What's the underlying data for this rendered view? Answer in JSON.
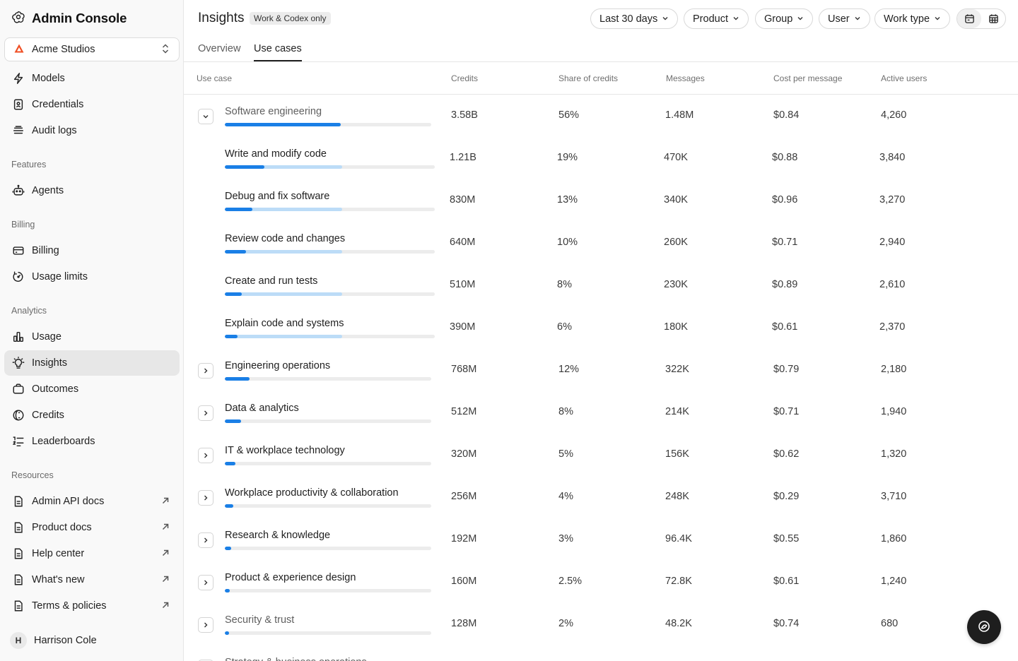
{
  "app": {
    "title": "Admin Console"
  },
  "org": {
    "name": "Acme Studios"
  },
  "sidebar": {
    "top_items": [
      {
        "label": "Models",
        "icon": "bolt-icon"
      },
      {
        "label": "Credentials",
        "icon": "id-badge-icon"
      },
      {
        "label": "Audit logs",
        "icon": "list-stack-icon"
      }
    ],
    "features_label": "Features",
    "features_items": [
      {
        "label": "Agents",
        "icon": "robot-icon"
      }
    ],
    "billing_label": "Billing",
    "billing_items": [
      {
        "label": "Billing",
        "icon": "credit-card-icon"
      },
      {
        "label": "Usage limits",
        "icon": "gauge-icon"
      }
    ],
    "analytics_label": "Analytics",
    "analytics_items": [
      {
        "label": "Usage",
        "icon": "bar-chart-icon"
      },
      {
        "label": "Insights",
        "icon": "lightbulb-icon",
        "active": true
      },
      {
        "label": "Outcomes",
        "icon": "briefcase-icon"
      },
      {
        "label": "Credits",
        "icon": "coin-icon"
      },
      {
        "label": "Leaderboards",
        "icon": "ranked-list-icon"
      }
    ],
    "resources_label": "Resources",
    "resources_items": [
      {
        "label": "Admin API docs",
        "icon": "document-icon"
      },
      {
        "label": "Product docs",
        "icon": "document-icon"
      },
      {
        "label": "Help center",
        "icon": "document-icon"
      },
      {
        "label": "What's new",
        "icon": "document-icon"
      },
      {
        "label": "Terms & policies",
        "icon": "document-icon"
      }
    ],
    "user": {
      "initial": "H",
      "name": "Harrison Cole"
    }
  },
  "header": {
    "title": "Insights",
    "badge": "Work & Codex only",
    "filters": [
      "Last 30 days",
      "Product",
      "Group",
      "User",
      "Work type"
    ],
    "tabs": [
      {
        "label": "Overview"
      },
      {
        "label": "Use cases",
        "active": true
      }
    ]
  },
  "table": {
    "columns": [
      "Use case",
      "Credits",
      "Share of credits",
      "Messages",
      "Cost per message",
      "Active users"
    ],
    "rows": [
      {
        "name": "Software engineering",
        "credits": "3.58B",
        "share": "56%",
        "messages": "1.48M",
        "cost": "$0.84",
        "users": "4,260",
        "share_fraction": 0.56,
        "expanded": true,
        "level": 0,
        "muted": true
      },
      {
        "name": "Write and modify code",
        "credits": "1.21B",
        "share": "19%",
        "messages": "470K",
        "cost": "$0.88",
        "users": "3,840",
        "share_fraction": 0.19,
        "level": 1
      },
      {
        "name": "Debug and fix software",
        "credits": "830M",
        "share": "13%",
        "messages": "340K",
        "cost": "$0.96",
        "users": "3,270",
        "share_fraction": 0.13,
        "level": 1
      },
      {
        "name": "Review code and changes",
        "credits": "640M",
        "share": "10%",
        "messages": "260K",
        "cost": "$0.71",
        "users": "2,940",
        "share_fraction": 0.1,
        "level": 1
      },
      {
        "name": "Create and run tests",
        "credits": "510M",
        "share": "8%",
        "messages": "230K",
        "cost": "$0.89",
        "users": "2,610",
        "share_fraction": 0.08,
        "level": 1
      },
      {
        "name": "Explain code and systems",
        "credits": "390M",
        "share": "6%",
        "messages": "180K",
        "cost": "$0.61",
        "users": "2,370",
        "share_fraction": 0.06,
        "level": 1
      },
      {
        "name": "Engineering operations",
        "credits": "768M",
        "share": "12%",
        "messages": "322K",
        "cost": "$0.79",
        "users": "2,180",
        "share_fraction": 0.12,
        "level": 0
      },
      {
        "name": "Data & analytics",
        "credits": "512M",
        "share": "8%",
        "messages": "214K",
        "cost": "$0.71",
        "users": "1,940",
        "share_fraction": 0.08,
        "level": 0
      },
      {
        "name": "IT & workplace technology",
        "credits": "320M",
        "share": "5%",
        "messages": "156K",
        "cost": "$0.62",
        "users": "1,320",
        "share_fraction": 0.05,
        "level": 0
      },
      {
        "name": "Workplace productivity & collaboration",
        "credits": "256M",
        "share": "4%",
        "messages": "248K",
        "cost": "$0.29",
        "users": "3,710",
        "share_fraction": 0.04,
        "level": 0
      },
      {
        "name": "Research & knowledge",
        "credits": "192M",
        "share": "3%",
        "messages": "96.4K",
        "cost": "$0.55",
        "users": "1,860",
        "share_fraction": 0.03,
        "level": 0
      },
      {
        "name": "Product & experience design",
        "credits": "160M",
        "share": "2.5%",
        "messages": "72.8K",
        "cost": "$0.61",
        "users": "1,240",
        "share_fraction": 0.025,
        "level": 0
      },
      {
        "name": "Security & trust",
        "credits": "128M",
        "share": "2%",
        "messages": "48.2K",
        "cost": "$0.74",
        "users": "680",
        "share_fraction": 0.02,
        "level": 0,
        "muted": true
      },
      {
        "name": "Strategy & business operations",
        "credits": "",
        "share": "",
        "messages": "",
        "cost": "",
        "users": "",
        "share_fraction": 0.01,
        "level": 0,
        "muted": true
      }
    ]
  },
  "colors": {
    "accent": "#1a7fe6",
    "accent_light": "#bcdcf7",
    "track": "#ececec"
  }
}
